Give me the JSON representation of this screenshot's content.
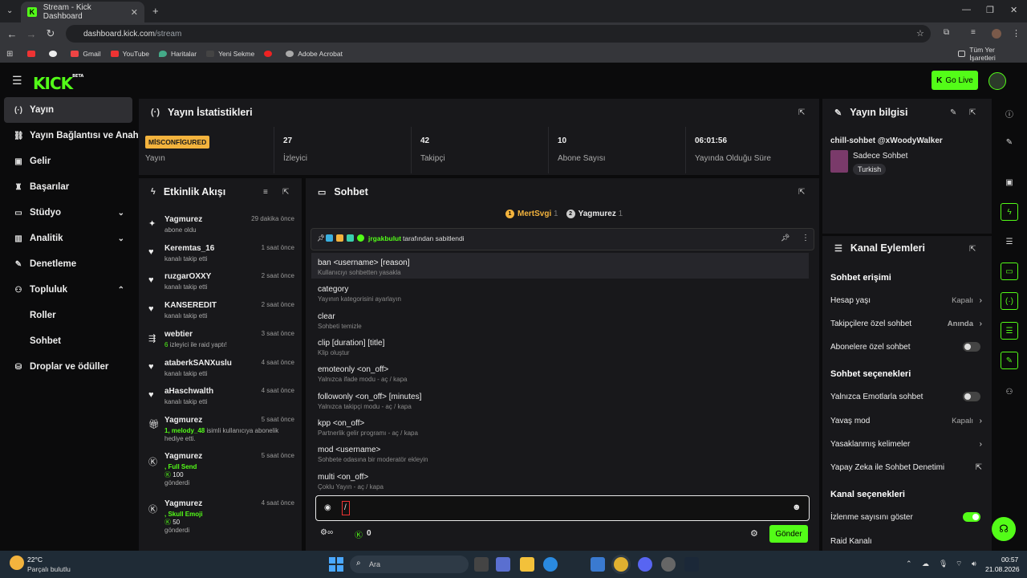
{
  "browser": {
    "tab_title": "Stream - Kick Dashboard",
    "tab_fav": "K",
    "url_host": "dashboard.kick.com",
    "url_path": "/stream",
    "bookmarks": [
      "Gmail",
      "YouTube",
      "Haritalar",
      "Yeni Sekme",
      "Adobe Acrobat"
    ],
    "all_bookmarks": "Tüm Yer İşaretleri"
  },
  "header": {
    "logo": "KICK",
    "logo_beta": "BETA",
    "go_live": "Go Live"
  },
  "sidebar": {
    "items": [
      {
        "label": "Yayın",
        "icon": "broadcast-icon"
      },
      {
        "label": "Yayın Bağlantısı ve Anahtarı",
        "icon": "link-icon"
      },
      {
        "label": "Gelir",
        "icon": "revenue-icon"
      },
      {
        "label": "Başarılar",
        "icon": "trophy-icon"
      },
      {
        "label": "Stüdyo",
        "icon": "studio-icon"
      },
      {
        "label": "Analitik",
        "icon": "chart-icon"
      },
      {
        "label": "Denetleme",
        "icon": "wrench-icon"
      },
      {
        "label": "Topluluk",
        "icon": "community-icon"
      },
      {
        "label": "Roller",
        "icon": ""
      },
      {
        "label": "Sohbet",
        "icon": ""
      },
      {
        "label": "Droplar ve ödüller",
        "icon": "drops-icon"
      }
    ]
  },
  "stats": {
    "title": "Yayın İstatistikleri",
    "status_badge": "MİSCONFİGURED",
    "cells": [
      {
        "value": "",
        "label": "Yayın"
      },
      {
        "value": "27",
        "label": "İzleyici"
      },
      {
        "value": "42",
        "label": "Takipçi"
      },
      {
        "value": "10",
        "label": "Abone Sayısı"
      },
      {
        "value": "06:01:56",
        "label": "Yayında Olduğu Süre"
      }
    ]
  },
  "info": {
    "title": "Yayın bilgisi",
    "stream_title": "chill-sohbet @xWoodyWalker",
    "category": "Sadece Sohbet",
    "tag": "Turkish"
  },
  "activity": {
    "title": "Etkinlik Akışı",
    "items": [
      {
        "name": "Yagmurez",
        "time": "29 dakika önce",
        "sub": "abone oldu",
        "icon": "star-icon"
      },
      {
        "name": "Keremtas_16",
        "time": "1 saat önce",
        "sub": "kanalı takip etti",
        "icon": "heart-icon"
      },
      {
        "name": "ruzgarOXXY",
        "time": "2 saat önce",
        "sub": "kanalı takip etti",
        "icon": "heart-icon"
      },
      {
        "name": "KANSEREDIT",
        "time": "2 saat önce",
        "sub": "kanalı takip etti",
        "icon": "heart-icon"
      },
      {
        "name": "webtier",
        "time": "3 saat önce",
        "sub_pre": "6",
        "sub": " izleyici ile raid yaptı!",
        "icon": "raid-icon"
      },
      {
        "name": "ataberkSANXuslu",
        "time": "4 saat önce",
        "sub": "kanalı takip etti",
        "icon": "heart-icon"
      },
      {
        "name": "aHaschwalth",
        "time": "4 saat önce",
        "sub": "kanalı takip etti",
        "icon": "heart-icon"
      },
      {
        "name": "Yagmurez",
        "time": "5 saat önce",
        "sub_pre": "1, melody_48",
        "sub": " isimli kullanıcıya abonelik hediye etti.",
        "icon": "gift-icon"
      },
      {
        "name": "Yagmurez",
        "time": "5 saat önce",
        "sub_pre": ", Full Send",
        "amount": "100",
        "sub": "gönderdi",
        "icon": "kicks-icon"
      },
      {
        "name": "Yagmurez",
        "time": "4 saat önce",
        "sub_pre": ", Skull Emoji",
        "amount": "50",
        "sub": "gönderdi",
        "icon": "kicks-icon"
      }
    ]
  },
  "chat": {
    "title": "Sohbet",
    "leaders": [
      {
        "name": "MertSvgi",
        "count": "1",
        "rank": "1"
      },
      {
        "name": "Yagmurez",
        "count": "1",
        "rank": "2"
      }
    ],
    "pinned_by": "jrgakbulut",
    "pinned_text": "tarafından sabitlendi",
    "commands": [
      {
        "cmd": "ban <username> [reason]",
        "desc": "Kullanıcıyı sohbetten yasakla"
      },
      {
        "cmd": "category",
        "desc": "Yayının kategorisini ayarlayın"
      },
      {
        "cmd": "clear",
        "desc": "Sohbeti temizle"
      },
      {
        "cmd": "clip [duration] [title]",
        "desc": "Klip oluştur"
      },
      {
        "cmd": "emoteonly <on_off>",
        "desc": "Yalnızca ifade modu - aç / kapa"
      },
      {
        "cmd": "followonly <on_off> [minutes]",
        "desc": "Yalnızca takipçi modu - aç / kapa"
      },
      {
        "cmd": "kpp <on_off>",
        "desc": "Partnerlik gelir programı - aç / kapa"
      },
      {
        "cmd": "mod <username>",
        "desc": "Sohbete odasına bir moderatör ekleyin"
      },
      {
        "cmd": "multi <on_off>",
        "desc": "Çoklu Yayın - aç / kapa"
      }
    ],
    "input_value": "/",
    "kicks": "0",
    "send": "Gönder"
  },
  "actions": {
    "title": "Kanal Eylemleri",
    "sec1": "Sohbet erişimi",
    "hesap": "Hesap yaşı",
    "hesap_val": "Kapalı",
    "takipci": "Takipçilere özel sohbet",
    "takipci_val": "Anında",
    "abone": "Abonelere özel sohbet",
    "sec2": "Sohbet seçenekleri",
    "emote": "Yalnızca Emotlarla sohbet",
    "yavas": "Yavaş mod",
    "yavas_val": "Kapalı",
    "yasak": "Yasaklanmış kelimeler",
    "ai": "Yapay Zeka ile Sohbet Denetimi",
    "sec3": "Kanal seçenekleri",
    "izlenme": "İzlenme sayısını göster",
    "raid": "Raid Kanalı"
  },
  "taskbar": {
    "weather_temp": "22°C",
    "weather_desc": "Parçalı bulutlu",
    "search": "Ara",
    "time": "00:57",
    "date": "21.08.2026"
  }
}
